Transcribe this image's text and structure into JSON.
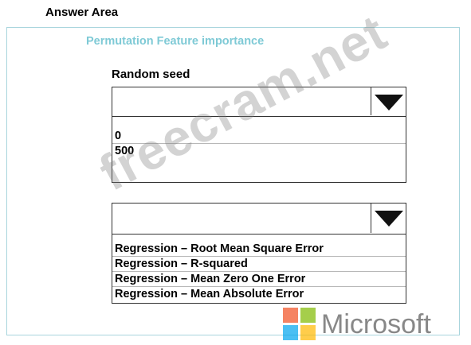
{
  "answer_area": {
    "title": "Answer Area"
  },
  "panel": {
    "heading": "Permutation Feature importance"
  },
  "random_seed": {
    "label": "Random seed",
    "options": [
      "0",
      "500"
    ]
  },
  "metric": {
    "options": [
      "Regression – Root Mean Square Error",
      "Regression – R-squared",
      "Regression – Mean Zero One Error",
      "Regression – Mean Absolute Error"
    ]
  },
  "watermark": {
    "text": "freecram.net"
  },
  "logo": {
    "text": "Microsoft",
    "colors": [
      "#f25022",
      "#7fba00",
      "#00a4ef",
      "#ffb900"
    ]
  },
  "colors": {
    "heading": "#7fcad6",
    "panel_border": "#a9d5dd"
  }
}
